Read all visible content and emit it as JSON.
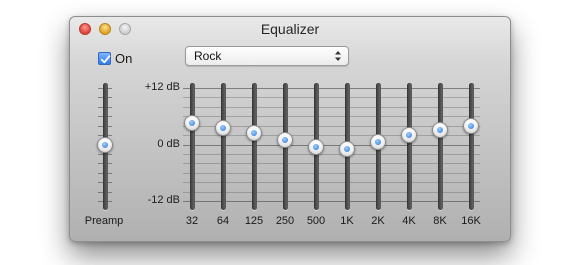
{
  "window": {
    "title": "Equalizer"
  },
  "controls": {
    "on_label": "On",
    "on_checked": true,
    "preset_value": "Rock"
  },
  "scale": {
    "max_label": "+12 dB",
    "mid_label": "0 dB",
    "min_label": "-12 dB",
    "max_db": 12,
    "min_db": -12
  },
  "preamp": {
    "label": "Preamp",
    "value_db": 0
  },
  "bands": [
    {
      "label": "32",
      "value_db": 4.5
    },
    {
      "label": "64",
      "value_db": 3.5
    },
    {
      "label": "125",
      "value_db": 2.5
    },
    {
      "label": "250",
      "value_db": 1.0
    },
    {
      "label": "500",
      "value_db": -0.5
    },
    {
      "label": "1K",
      "value_db": -1.0
    },
    {
      "label": "2K",
      "value_db": 0.5
    },
    {
      "label": "4K",
      "value_db": 2.0
    },
    {
      "label": "8K",
      "value_db": 3.0
    },
    {
      "label": "16K",
      "value_db": 4.0
    }
  ],
  "colors": {
    "accent": "#2f7be8",
    "window_top": "#e9e9e9",
    "window_bottom": "#b0b0b0",
    "track": "#3b3b3b"
  }
}
